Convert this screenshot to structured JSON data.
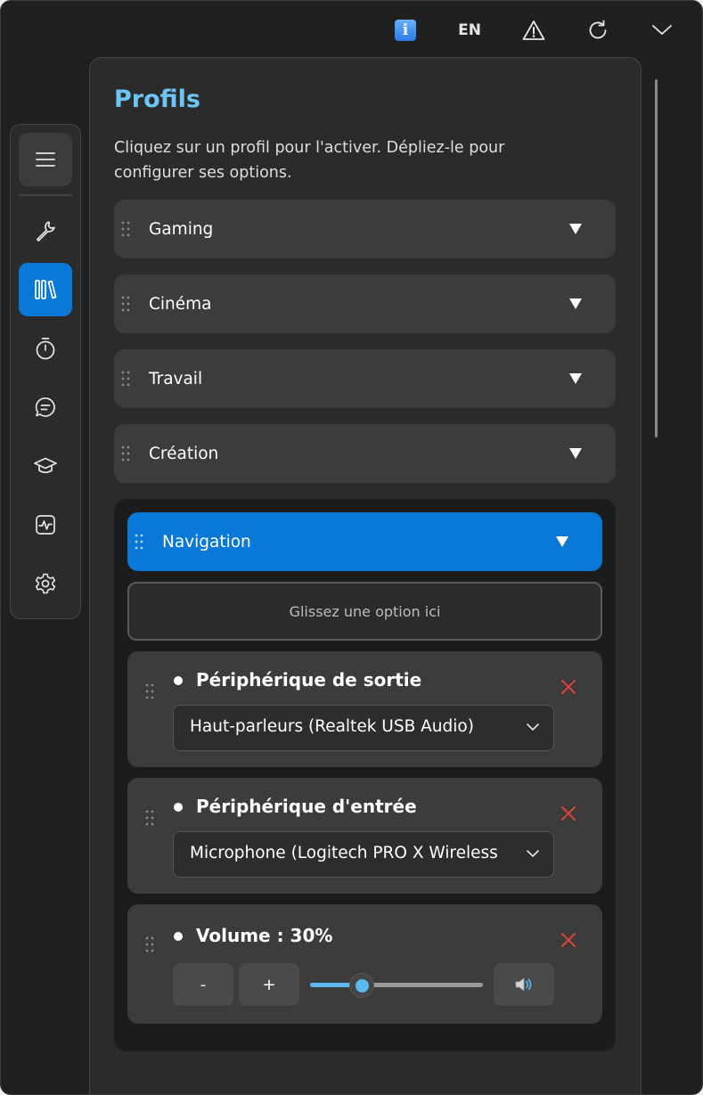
{
  "topbar": {
    "info_label": "i",
    "language": "EN"
  },
  "nav": {
    "items": [
      "menu-icon",
      "wrench-icon",
      "library-icon",
      "stopwatch-icon",
      "chat-icon",
      "graduation-cap-icon",
      "activity-icon",
      "gear-icon"
    ],
    "active": "library-icon"
  },
  "page": {
    "title": "Profils",
    "subtitle": "Cliquez sur un profil pour l'activer. Dépliez-le pour configurer ses options."
  },
  "profiles": [
    {
      "label": "Gaming"
    },
    {
      "label": "Cinéma"
    },
    {
      "label": "Travail"
    },
    {
      "label": "Création"
    },
    {
      "label": "Navigation"
    }
  ],
  "expanded": {
    "dropzone_label": "Glissez une option ici",
    "options": [
      {
        "title": "Périphérique de sortie",
        "value": "Haut-parleurs (Realtek USB Audio)"
      },
      {
        "title": "Périphérique d'entrée",
        "value": "Microphone (Logitech PRO X Wireless"
      },
      {
        "title": "Volume : 30%",
        "minus": "-",
        "plus": "+",
        "volume": 30
      }
    ]
  },
  "colors": {
    "accent": "#0a78d7",
    "title": "#6cc5f5",
    "close": "#e0413c"
  }
}
